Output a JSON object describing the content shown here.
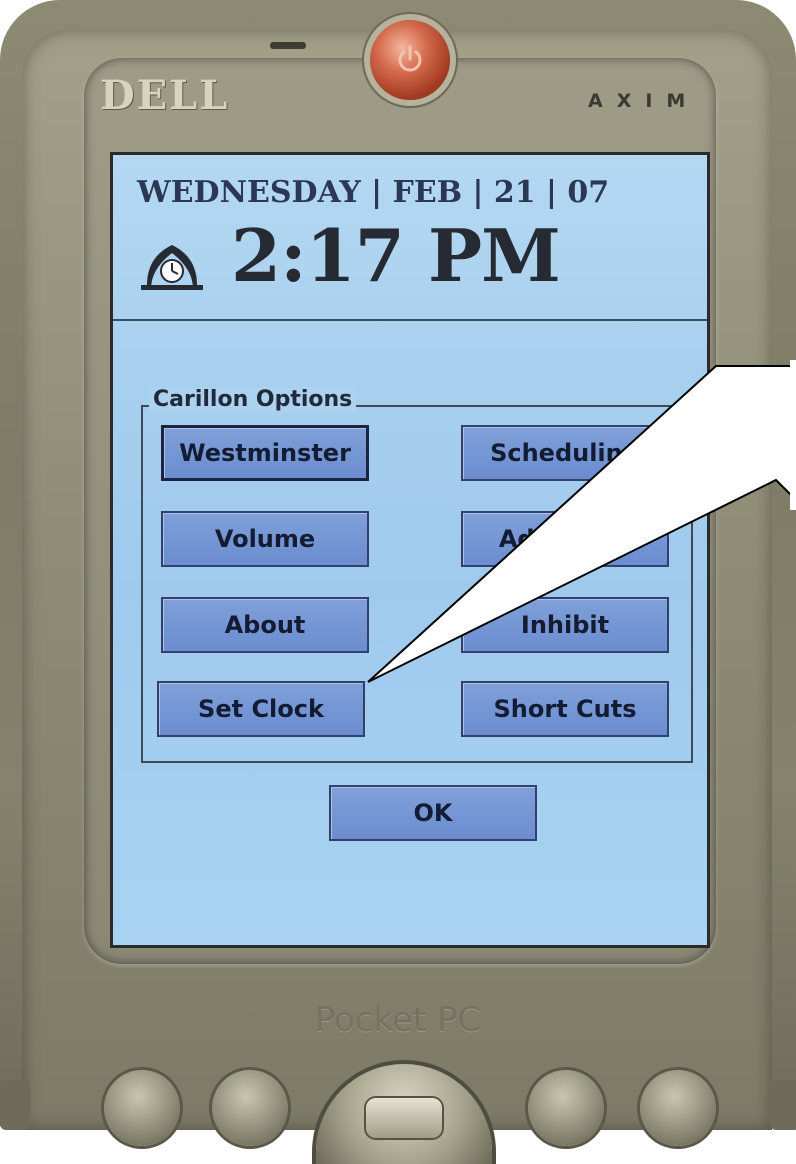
{
  "device": {
    "brand": "DELL",
    "model": "AXIM",
    "platform": "Pocket PC"
  },
  "header": {
    "date_line": "WEDNESDAY | FEB | 21 | 07",
    "time": "2:17 PM"
  },
  "options_group": {
    "label": "Carillon Options",
    "buttons": [
      {
        "label": "Westminster"
      },
      {
        "label": "Scheduling"
      },
      {
        "label": "Volume"
      },
      {
        "label": "Advanced"
      },
      {
        "label": "About"
      },
      {
        "label": "Inhibit"
      },
      {
        "label": "Set Clock"
      },
      {
        "label": "Short Cuts"
      }
    ]
  },
  "ok_button": {
    "label": "OK"
  },
  "colors": {
    "screen_background": "#a7cfee",
    "button_fill": "#7fa0d8",
    "button_border": "#33406a",
    "header_text": "#2c3754",
    "device_body": "#8d8a73",
    "power_button": "#d46a4c"
  },
  "icons": {
    "power": "power-icon",
    "clock": "mantel-clock-icon"
  }
}
